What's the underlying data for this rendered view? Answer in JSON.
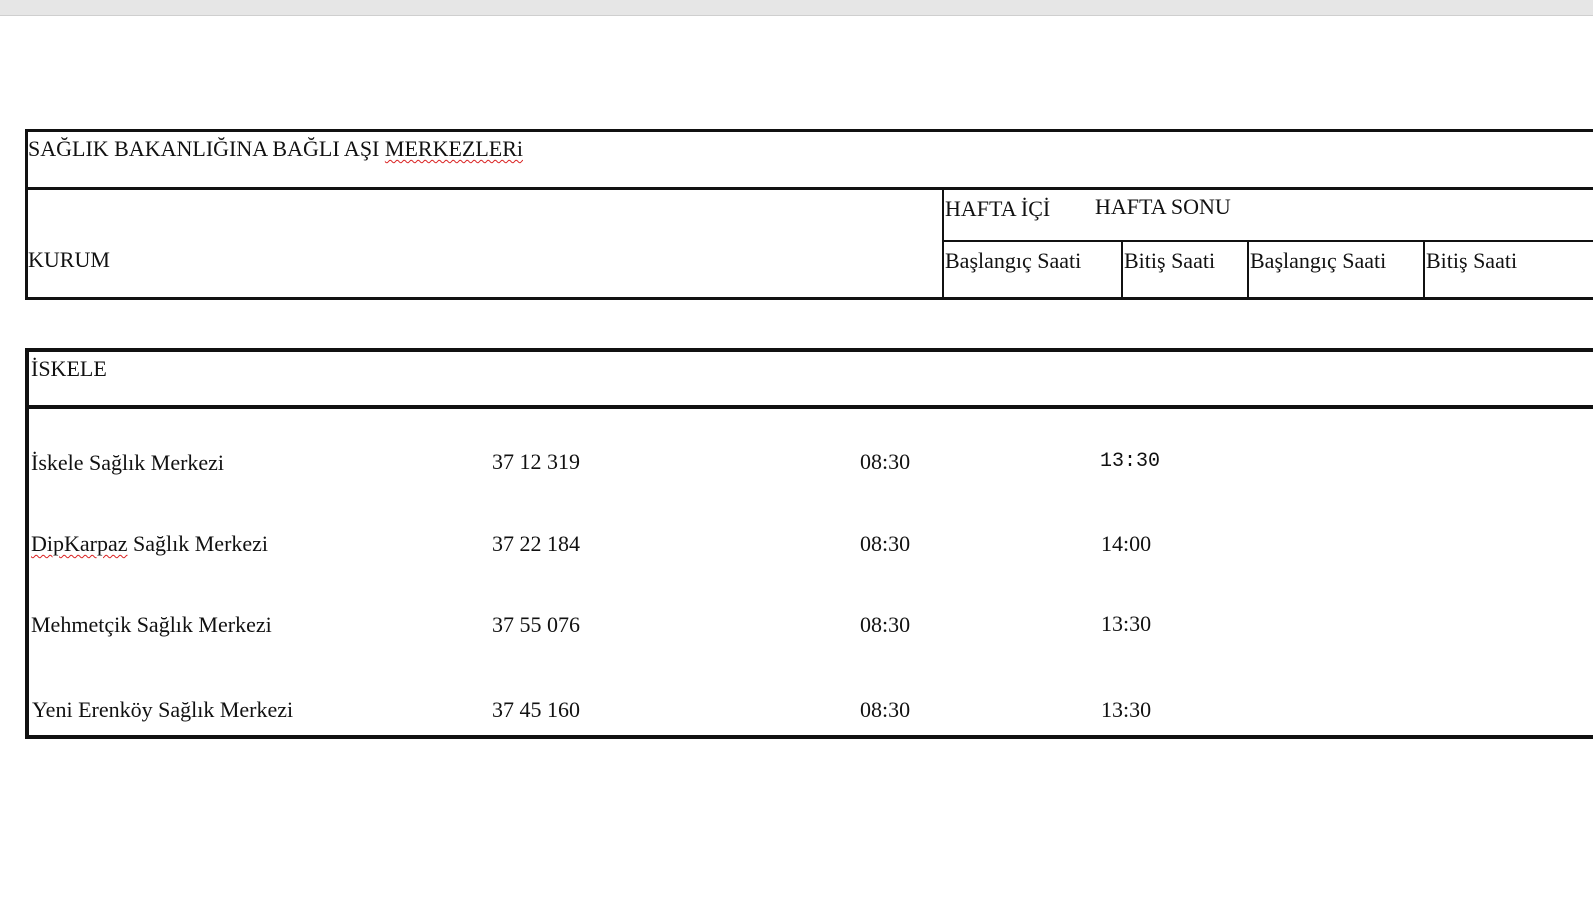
{
  "header_table": {
    "title_prefix": "SAĞLIK BAKANLIĞINA  BAĞLI AŞI ",
    "title_flagged": "MERKEZLERi",
    "kurum_label": "KURUM",
    "weekday_label": "HAFTA  İÇİ",
    "weekend_label": "HAFTA SONU",
    "columns": [
      "Başlangıç Saati",
      "Bitiş Saati",
      "Başlangıç Saati",
      "Bitiş Saati"
    ]
  },
  "district_table": {
    "district": "İSKELE",
    "rows": [
      {
        "name_prefix": "",
        "name_flagged": "",
        "name": "İskele Sağlık Merkezi",
        "phone": "37 12 319",
        "weekday_start": "08:30",
        "weekday_end": "13:30"
      },
      {
        "name_prefix": "",
        "name_flagged": "DipKarpaz",
        "name": " Sağlık Merkezi",
        "phone": "37 22 184",
        "weekday_start": "08:30",
        "weekday_end": "14:00"
      },
      {
        "name_prefix": "",
        "name_flagged": "",
        "name": "Mehmetçik Sağlık Merkezi",
        "phone": "37 55 076",
        "weekday_start": "08:30",
        "weekday_end": "13:30"
      },
      {
        "name_prefix": "",
        "name_flagged": "",
        "name": "Yeni Erenköy Sağlık Merkezi",
        "phone": "37 45 160",
        "weekday_start": "08:30",
        "weekday_end": "13:30"
      }
    ]
  }
}
